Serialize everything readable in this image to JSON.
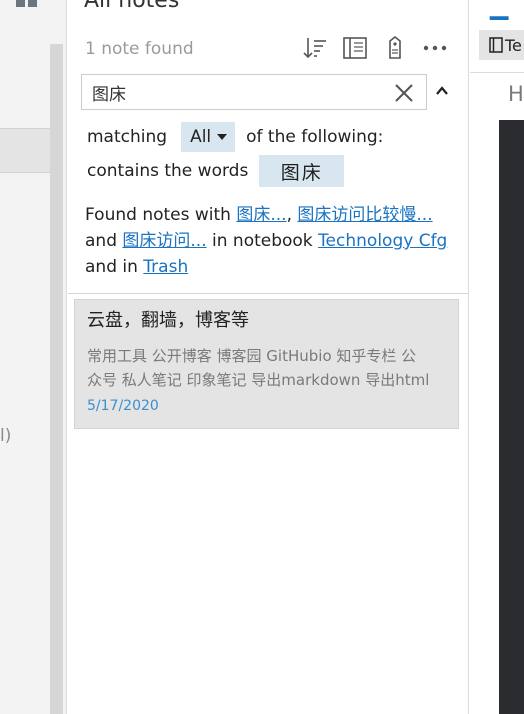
{
  "list": {
    "title": "All notes",
    "count_text": "1 note found",
    "toolbar": {
      "sort_icon": "sort-descending-icon",
      "notebook_icon": "notebook-icon",
      "tag_icon": "tag-icon",
      "more_icon": "more-horizontal-icon"
    }
  },
  "search": {
    "value": "图床",
    "placeholder": ""
  },
  "filter": {
    "matching_label": "matching",
    "match_mode": "All",
    "following_label": "of the following:",
    "contains_label": "contains the words",
    "term": "图床"
  },
  "found": {
    "prefix": "Found notes with ",
    "link1": "图床...",
    "sep1": ", ",
    "link2": "图床访问比较慢...",
    "and1": " and ",
    "link3": "图床访问...",
    "in_nb": " in notebook ",
    "notebook": "Technology Cfg",
    "and_in": " and in ",
    "trash": "Trash"
  },
  "notes": [
    {
      "title": "云盘，翻墙，博客等",
      "snippet_line1": "常用工具 公开博客 博客园 GitHubio 知乎专栏 公",
      "snippet_line2": "众号 私人笔记 印象笔记 导出markdown 导出html",
      "date": "5/17/2020"
    }
  ],
  "left": {
    "cut_text": "l)"
  },
  "right": {
    "notebook_chip": "Te",
    "heading_btn": "H"
  },
  "colors": {
    "accent": "#1a73c2",
    "chip_bg": "#d7e6ef",
    "selected_bg": "#e4e4e4",
    "date": "#3a8fd0"
  }
}
